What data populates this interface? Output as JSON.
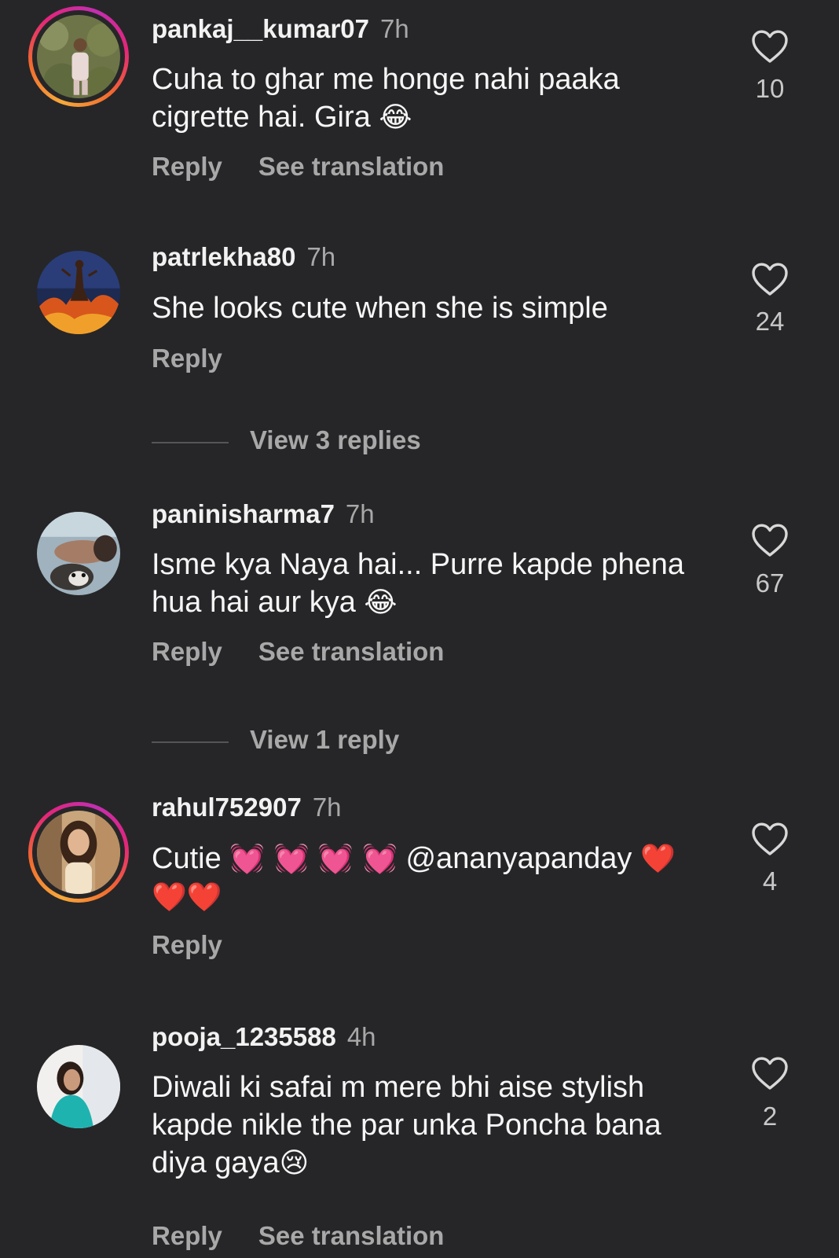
{
  "comments": [
    {
      "username": "pankaj__kumar07",
      "time": "7h",
      "text_lines": [
        "Cuha to ghar me honge nahi paaka",
        "cigrette hai. Gira"
      ],
      "emoji": "😂",
      "reply_label": "Reply",
      "translation_label": "See translation",
      "likes": "10",
      "avatar_icon": "avatar-photo-person-outdoor",
      "has_story_ring": true
    },
    {
      "username": "patrlekha80",
      "time": "7h",
      "text_lines": [
        "She looks cute when she is simple"
      ],
      "reply_label": "Reply",
      "likes": "24",
      "avatar_icon": "avatar-art-fire-figure",
      "has_story_ring": false,
      "view_replies": "View 3 replies"
    },
    {
      "username": "paninisharma7",
      "time": "7h",
      "text_lines": [
        "Isme kya Naya hai... Purre kapde phena",
        "hua hai aur kya"
      ],
      "emoji": "😂",
      "reply_label": "Reply",
      "translation_label": "See translation",
      "likes": "67",
      "avatar_icon": "avatar-photo-man-with-dog",
      "has_story_ring": false,
      "view_replies": "View 1 reply"
    },
    {
      "username": "rahul752907",
      "time": "7h",
      "text_prefix": "Cutie",
      "hearts_pink": "💓 💓 💓 💓",
      "mention": "@ananyapanday",
      "heart_red": "❤️",
      "hearts_red_line2": "❤️❤️",
      "reply_label": "Reply",
      "likes": "4",
      "avatar_icon": "avatar-photo-woman",
      "has_story_ring": true
    },
    {
      "username": "pooja_1235588",
      "time": "4h",
      "text_lines": [
        "Diwali ki safai m mere bhi aise stylish",
        "kapde nikle the par unka Poncha bana",
        "diya gaya"
      ],
      "emoji": "😢",
      "reply_label": "Reply",
      "translation_label": "See translation",
      "likes": "2",
      "avatar_icon": "avatar-photo-woman-teal",
      "has_story_ring": false
    }
  ],
  "colors": {
    "background": "#262628",
    "secondary_text": "#a8a8a8",
    "story_ring": [
      "#f7a93b",
      "#e3257a",
      "#c22fb0"
    ]
  }
}
